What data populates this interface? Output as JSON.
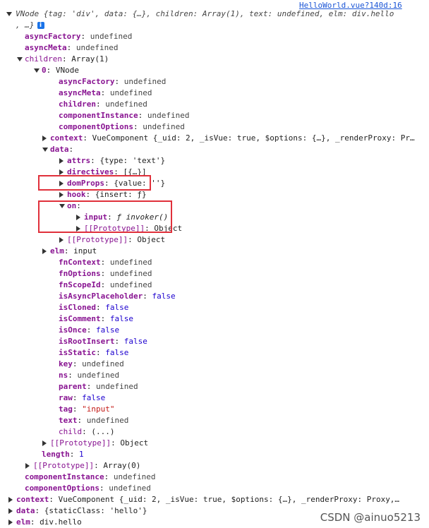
{
  "source_link": "HelloWorld.vue?140d:16",
  "header_line1": "VNode {tag: 'div', data: {…}, children: Array(1), text: undefined, elm: div.hello",
  "header_line2": ", …}",
  "info_icon": "i",
  "rows": [
    {
      "k": "asyncFactory",
      "v": "undefined",
      "vt": "undef"
    },
    {
      "k": "asyncMeta",
      "v": "undefined",
      "vt": "undef"
    },
    {
      "k": "children",
      "v": "Array(1)",
      "vt": "plain"
    },
    {
      "k": "0",
      "v": "VNode",
      "vt": "plain"
    },
    {
      "k": "asyncFactory",
      "v": "undefined",
      "vt": "undef"
    },
    {
      "k": "asyncMeta",
      "v": "undefined",
      "vt": "undef"
    },
    {
      "k": "children",
      "v": "undefined",
      "vt": "undef"
    },
    {
      "k": "componentInstance",
      "v": "undefined",
      "vt": "undef"
    },
    {
      "k": "componentOptions",
      "v": "undefined",
      "vt": "undef"
    },
    {
      "k": "context",
      "v": "VueComponent {_uid: 2, _isVue: true, $options: {…}, _renderProxy: Pr…",
      "vt": "plain"
    },
    {
      "k": "data",
      "v": "",
      "vt": "plain"
    },
    {
      "k": "attrs",
      "v": "{type: 'text'}",
      "vt": "plain"
    },
    {
      "k": "directives",
      "v": "[{…}]",
      "vt": "plain"
    },
    {
      "k": "domProps",
      "v": "{value: ''}",
      "vt": "plain"
    },
    {
      "k": "hook",
      "v": "{insert: ƒ}",
      "vt": "plain"
    },
    {
      "k": "on",
      "v": "",
      "vt": "plain"
    },
    {
      "k": "input",
      "v": "ƒ invoker()",
      "vt": "fn"
    },
    {
      "k": "[[Prototype]]",
      "v": "Object",
      "vt": "plain"
    },
    {
      "k": "[[Prototype]]",
      "v": "Object",
      "vt": "plain"
    },
    {
      "k": "elm",
      "v": "input",
      "vt": "plain"
    },
    {
      "k": "fnContext",
      "v": "undefined",
      "vt": "undef"
    },
    {
      "k": "fnOptions",
      "v": "undefined",
      "vt": "undef"
    },
    {
      "k": "fnScopeId",
      "v": "undefined",
      "vt": "undef"
    },
    {
      "k": "isAsyncPlaceholder",
      "v": "false",
      "vt": "bool"
    },
    {
      "k": "isCloned",
      "v": "false",
      "vt": "bool"
    },
    {
      "k": "isComment",
      "v": "false",
      "vt": "bool"
    },
    {
      "k": "isOnce",
      "v": "false",
      "vt": "bool"
    },
    {
      "k": "isRootInsert",
      "v": "false",
      "vt": "bool"
    },
    {
      "k": "isStatic",
      "v": "false",
      "vt": "bool"
    },
    {
      "k": "key",
      "v": "undefined",
      "vt": "undef"
    },
    {
      "k": "ns",
      "v": "undefined",
      "vt": "undef"
    },
    {
      "k": "parent",
      "v": "undefined",
      "vt": "undef"
    },
    {
      "k": "raw",
      "v": "false",
      "vt": "bool"
    },
    {
      "k": "tag",
      "v": "\"input\"",
      "vt": "str"
    },
    {
      "k": "text",
      "v": "undefined",
      "vt": "undef"
    },
    {
      "k": "child",
      "v": "(...)",
      "vt": "plain"
    },
    {
      "k": "[[Prototype]]",
      "v": "Object",
      "vt": "plain"
    },
    {
      "k": "length",
      "v": "1",
      "vt": "num"
    },
    {
      "k": "[[Prototype]]",
      "v": "Array(0)",
      "vt": "plain"
    },
    {
      "k": "componentInstance",
      "v": "undefined",
      "vt": "undef"
    },
    {
      "k": "componentOptions",
      "v": "undefined",
      "vt": "undef"
    },
    {
      "k": "context",
      "v": "VueComponent {_uid: 2, _isVue: true, $options: {…}, _renderProxy: Proxy,…",
      "vt": "plain"
    },
    {
      "k": "data",
      "v": "{staticClass: 'hello'}",
      "vt": "plain"
    },
    {
      "k": "elm",
      "v": "div.hello",
      "vt": "plain"
    }
  ],
  "watermark": "CSDN @ainuo5213"
}
